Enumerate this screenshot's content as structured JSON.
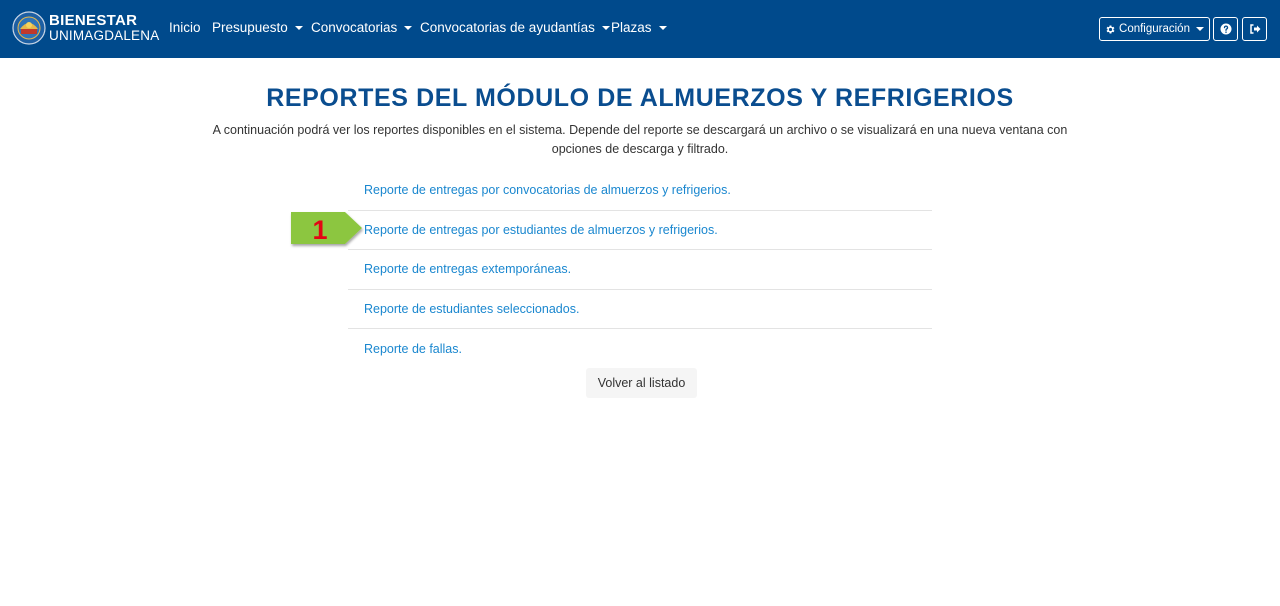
{
  "brand": {
    "line1": "BIENESTAR",
    "line2": "UNIMAGDALENA"
  },
  "nav": {
    "items": [
      {
        "label": "Inicio",
        "dropdown": false
      },
      {
        "label": "Presupuesto",
        "dropdown": true
      },
      {
        "label": "Convocatorias",
        "dropdown": true
      },
      {
        "label": "Convocatorias de ayudantías",
        "dropdown": true
      },
      {
        "label": "Plazas",
        "dropdown": true
      }
    ],
    "config_label": "Configuración"
  },
  "page": {
    "title": "REPORTES DEL MÓDULO DE ALMUERZOS Y REFRIGERIOS",
    "description": "A continuación podrá ver los reportes disponibles en el sistema. Depende del reporte se descargará un archivo o se visualizará en una nueva ventana con opciones de descarga y filtrado."
  },
  "reports": [
    "Reporte de entregas por convocatorias de almuerzos y refrigerios.",
    "Reporte de entregas por estudiantes de almuerzos y refrigerios.",
    "Reporte de entregas extemporáneas.",
    "Reporte de estudiantes seleccionados.",
    "Reporte de fallas."
  ],
  "back_button": "Volver al listado",
  "annotation": {
    "number": "1"
  },
  "colors": {
    "navbar": "#004a8c",
    "title": "#0a4d8f",
    "link": "#1a87cf",
    "marker": "#8cc63f",
    "marker_number": "#e30613"
  },
  "icons": {
    "config": "gear-icon",
    "help": "question-circle-icon",
    "logout": "sign-out-icon"
  }
}
